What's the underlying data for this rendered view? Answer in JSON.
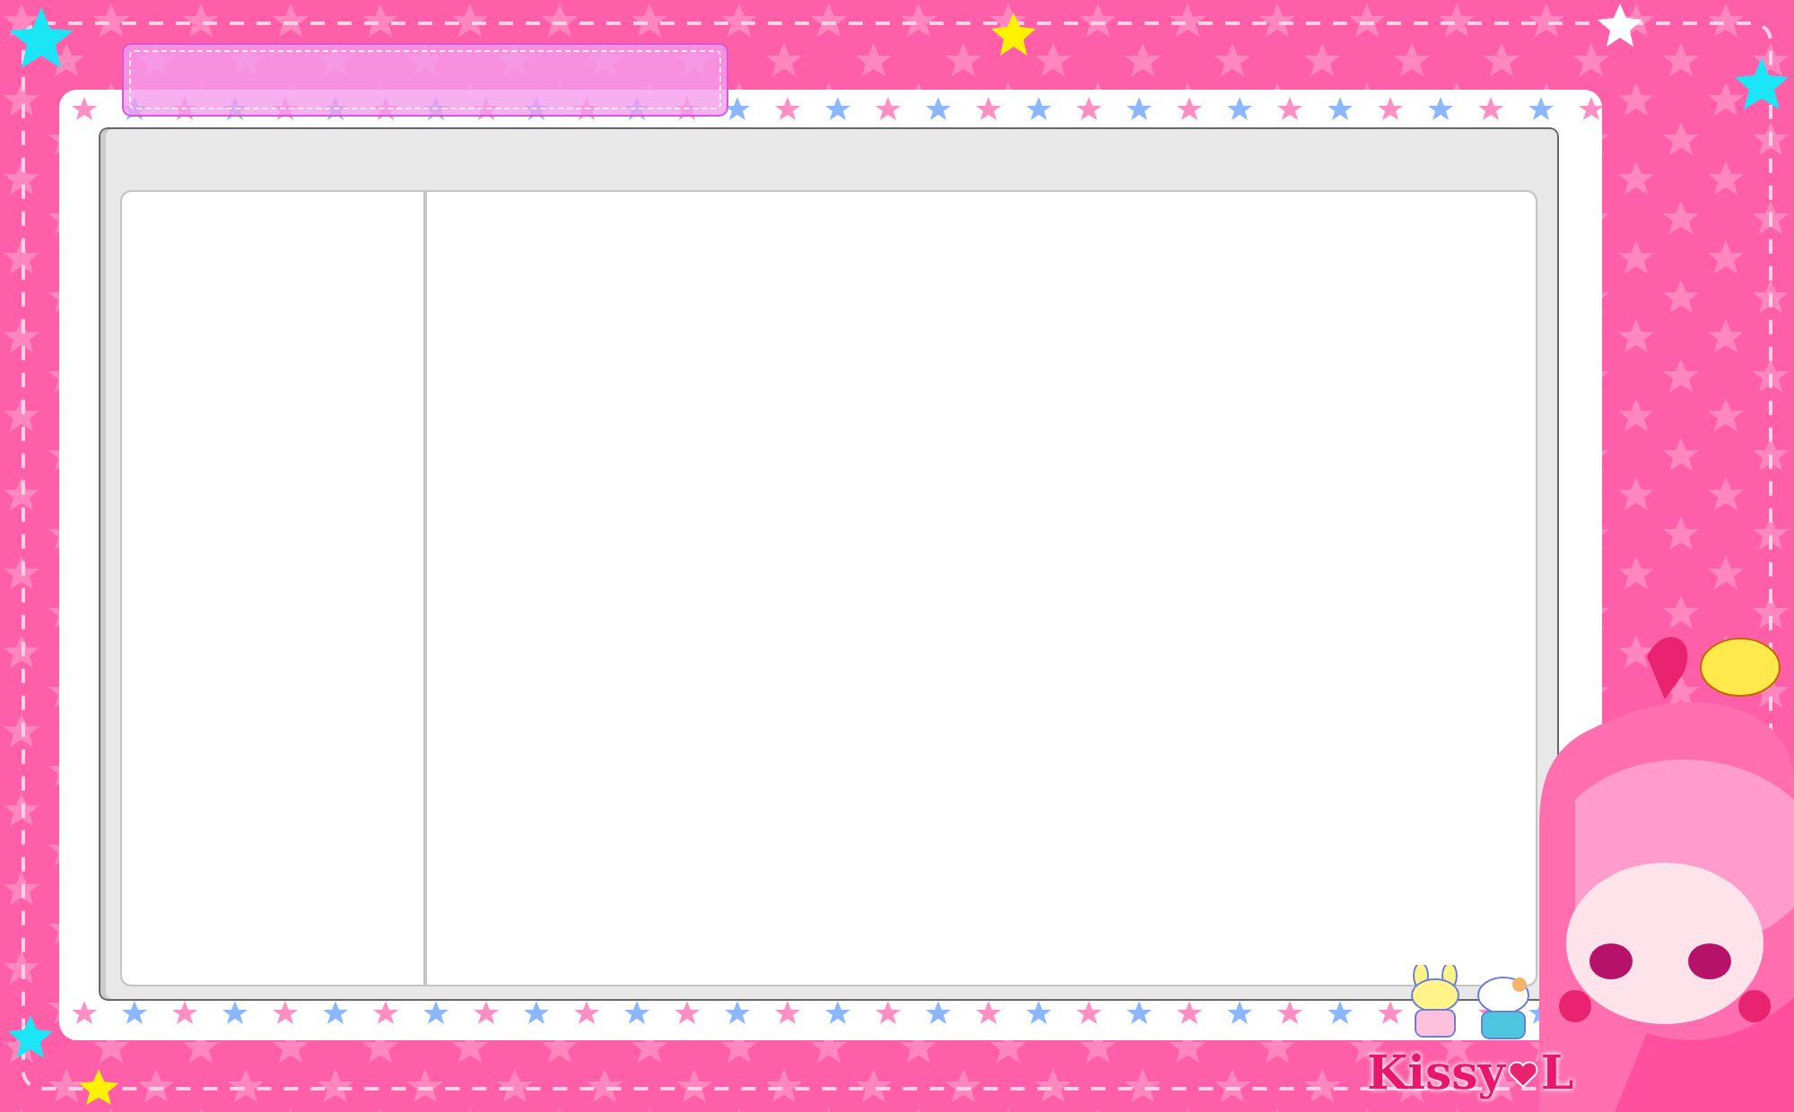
{
  "logo": {
    "first": "Kissy",
    "last": "L"
  }
}
